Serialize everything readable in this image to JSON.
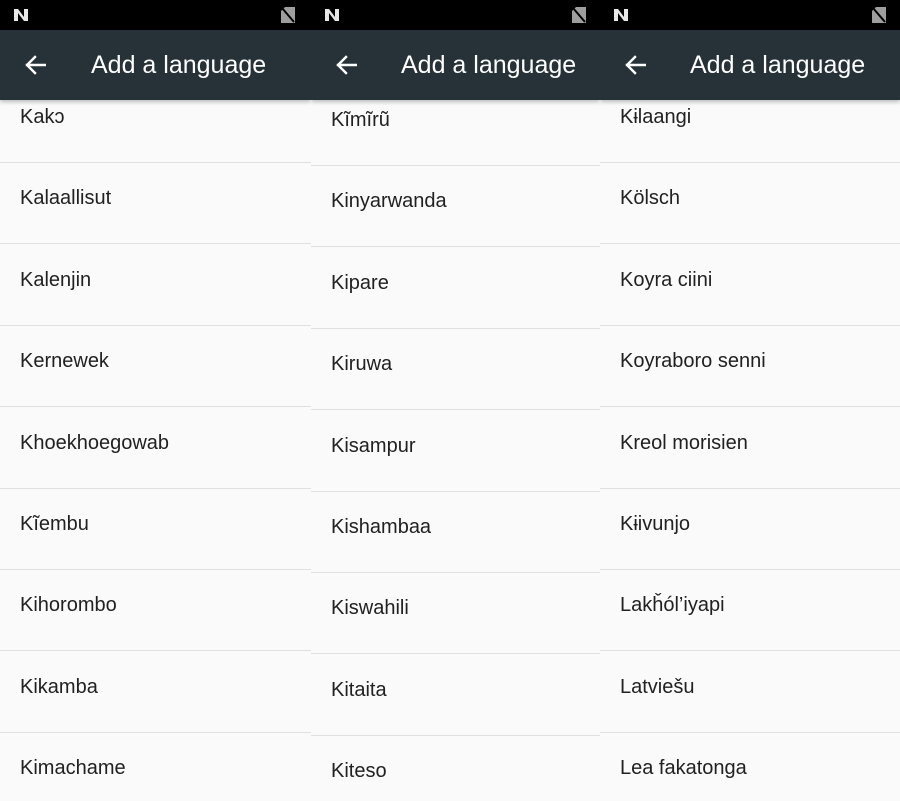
{
  "screens": [
    {
      "app_bar": {
        "title": "Add a language",
        "back_icon": "arrow-back-icon"
      },
      "status_bar": {
        "icons": [
          "n-notification-icon",
          "no-sim-icon"
        ]
      },
      "languages": [
        "Kakɔ",
        "Kalaallisut",
        "Kalenjin",
        "Kernewek",
        "Khoekhoegowab",
        "Kĩembu",
        "Kihorombo",
        "Kikamba",
        "Kimachame"
      ]
    },
    {
      "app_bar": {
        "title": "Add a language",
        "back_icon": "arrow-back-icon"
      },
      "status_bar": {
        "icons": [
          "n-notification-icon",
          "no-sim-icon"
        ]
      },
      "languages": [
        "Kĩmĩrũ",
        "Kinyarwanda",
        "Kipare",
        "Kiruwa",
        "Kisampur",
        "Kishambaa",
        "Kiswahili",
        "Kitaita",
        "Kiteso"
      ]
    },
    {
      "app_bar": {
        "title": "Add a language",
        "back_icon": "arrow-back-icon"
      },
      "status_bar": {
        "icons": [
          "n-notification-icon",
          "no-sim-icon"
        ]
      },
      "languages": [
        "Kɨlaangi",
        "Kölsch",
        "Koyra ciini",
        "Koyraboro senni",
        "Kreol morisien",
        "Kɨivunjo",
        "Lakȟól’iyapi",
        "Latviešu",
        "Lea fakatonga"
      ]
    }
  ],
  "colors": {
    "status_bar": "#000000",
    "app_bar": "#263238",
    "list_background": "#fafafa",
    "divider": "#e0e0e0",
    "text_primary": "#212121"
  }
}
